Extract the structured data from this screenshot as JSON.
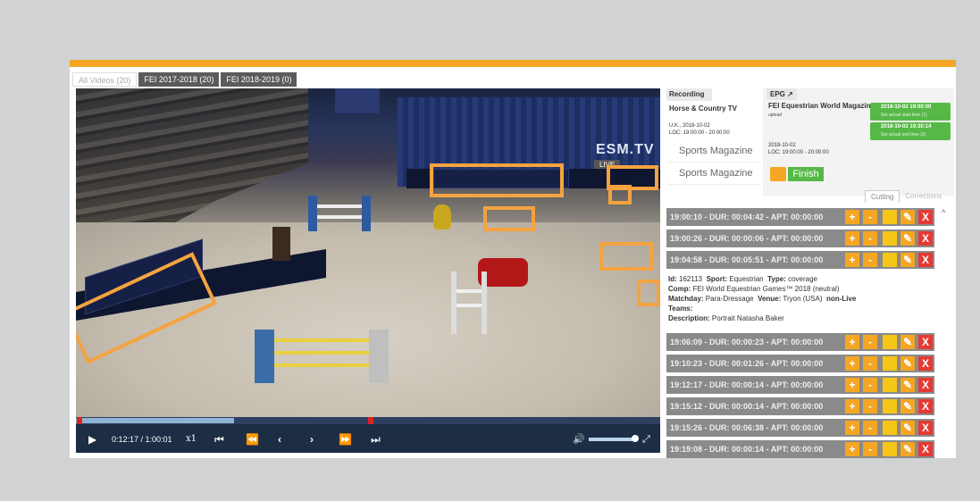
{
  "tabs": [
    {
      "label": "All Videos (20)"
    },
    {
      "label": "FEI 2017-2018 (20)"
    },
    {
      "label": "FEI 2018-2019 (0)"
    }
  ],
  "video": {
    "overlay_logo": "ESM.TV",
    "live_label": "LIVE",
    "time_display": "0:12:17 / 1:00:01",
    "speed": "x1",
    "progress": 0.27,
    "markers": [
      0.001,
      0.5
    ]
  },
  "recording": {
    "tab_label": "Recording",
    "channel": "Horse & Country TV",
    "loc_line1": "U.K., 2018-10-02",
    "loc_line2": "LOC: 19:00:00 - 20:00:00",
    "programs": [
      "Sports Magazine",
      "Sports Magazine"
    ]
  },
  "epg": {
    "tab_label": "EPG",
    "name": "FEI Equestrian World Magazine",
    "sub": "upload",
    "date_line1": "2018-10-02",
    "date_line2": "LOC: 19:00:00 - 20:00:00",
    "start": {
      "time": "2018-10-02 19:00:00",
      "note": "Set actual start time (1)"
    },
    "end": {
      "time": "2018-10-02 19:30:14",
      "note": "Set actual end time (2)"
    },
    "finish_label": "Finish"
  },
  "sub_tabs": [
    {
      "label": "Cutting"
    },
    {
      "label": "Corrections"
    }
  ],
  "clips_top": [
    {
      "label": "19:00:10 - DUR: 00:04:42 - APT: 00:00:00"
    },
    {
      "label": "19:00:26 - DUR: 00:00:06 - APT: 00:00:00"
    },
    {
      "label": "19:04:58 - DUR: 00:05:51 - APT: 00:00:00"
    }
  ],
  "detail": {
    "id_label": "Id:",
    "id_value": "162113",
    "sport_label": "Sport:",
    "sport_value": "Equestrian",
    "type_label": "Type:",
    "type_value": "coverage",
    "comp_label": "Comp:",
    "comp_value": "FEI World Equestrian Games™ 2018 (neutral)",
    "matchday_label": "Matchday:",
    "matchday_value": "Para-Dressage",
    "venue_label": "Venue:",
    "venue_value": "Tryon (USA)",
    "live_value": "non-Live",
    "teams_label": "Teams:",
    "desc_label": "Description:",
    "desc_value": "Portrait Natasha Baker"
  },
  "clips_bottom": [
    {
      "label": "19:06:09 - DUR: 00:00:23 - APT: 00:00:00"
    },
    {
      "label": "19:10:23 - DUR: 00:01:26 - APT: 00:00:00"
    },
    {
      "label": "19:12:17 - DUR: 00:00:14 - APT: 00:00:00"
    },
    {
      "label": "19:15:12 - DUR: 00:00:14 - APT: 00:00:00"
    },
    {
      "label": "19:15:26 - DUR: 00:06:38 - APT: 00:00:00"
    },
    {
      "label": "19:19:08 - DUR: 00:00:14 - APT: 00:00:00"
    }
  ],
  "colors": {
    "accent": "#f5a623",
    "green": "#56b947",
    "red": "#e53935",
    "highlight": "#f4a340"
  }
}
